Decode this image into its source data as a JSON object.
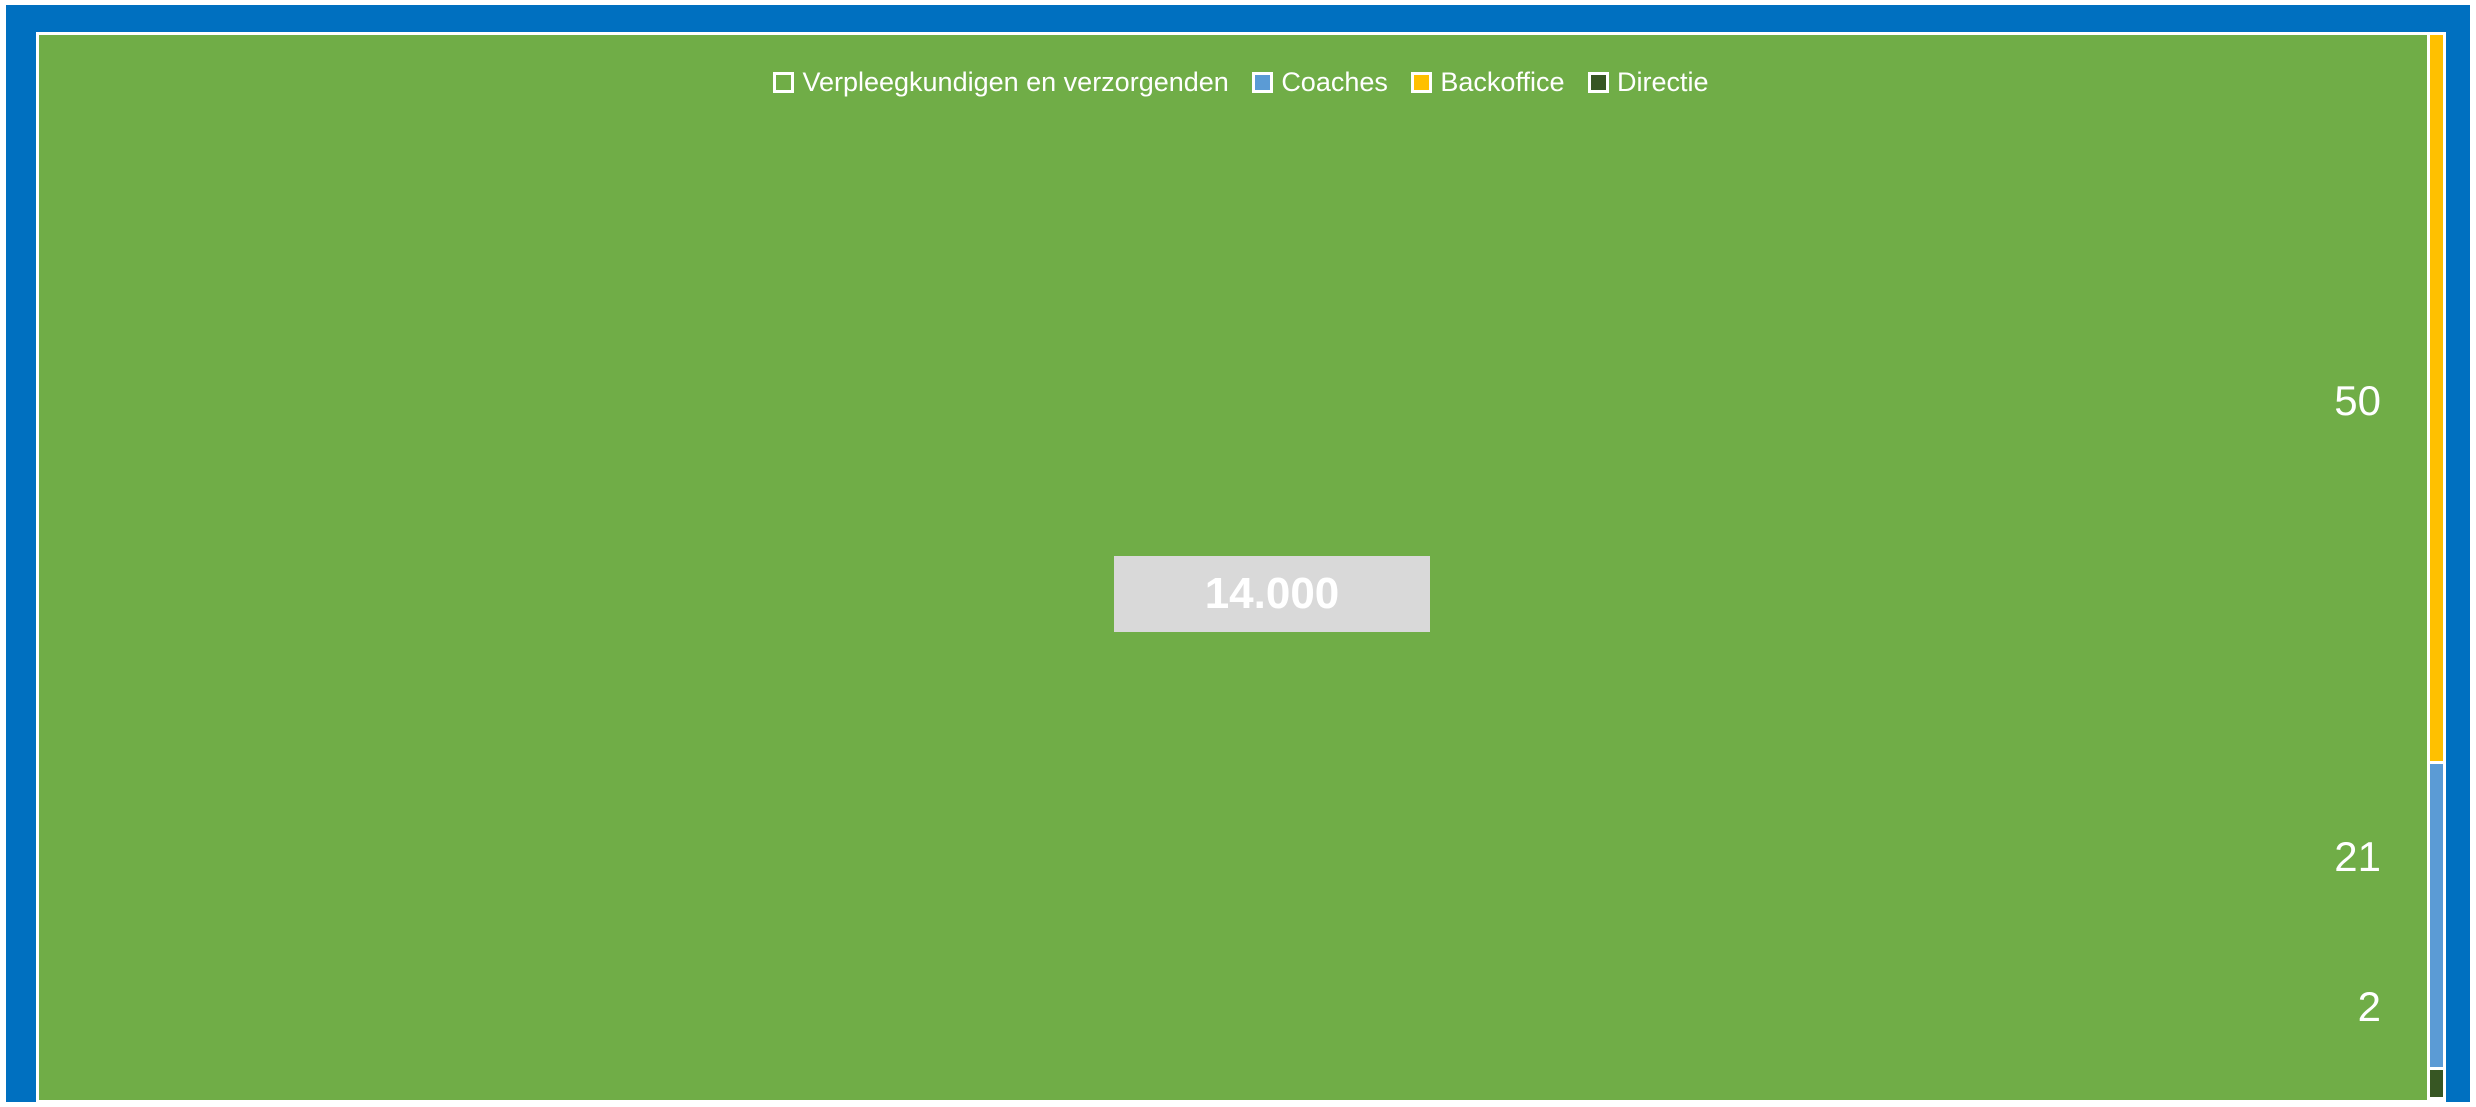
{
  "chart_data": {
    "type": "treemap",
    "series": [
      {
        "name": "Verpleegkundigen en verzorgenden",
        "value": 14000,
        "label": "14.000",
        "color": "#70ad47"
      },
      {
        "name": "Backoffice",
        "value": 50,
        "label": "50",
        "color": "#ffc000"
      },
      {
        "name": "Coaches",
        "value": 21,
        "label": "21",
        "color": "#5b9bd5"
      },
      {
        "name": "Directie",
        "value": 2,
        "label": "2",
        "color": "#375623"
      }
    ],
    "legend_position": "top",
    "legend": [
      {
        "name": "Verpleegkundigen en verzorgenden",
        "swatch": "#70ad47"
      },
      {
        "name": "Coaches",
        "swatch": "#5b9bd5"
      },
      {
        "name": "Backoffice",
        "swatch": "#ffc000"
      },
      {
        "name": "Directie",
        "swatch": "#375623"
      }
    ]
  }
}
